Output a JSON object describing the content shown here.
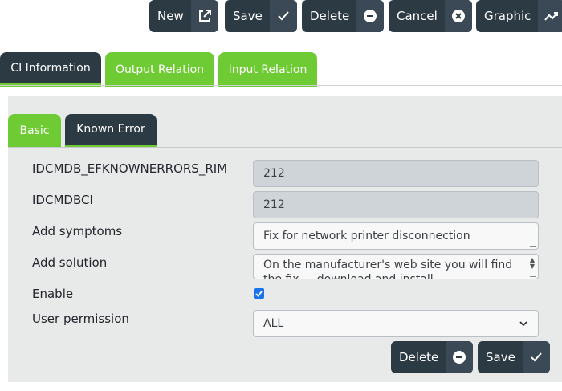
{
  "toolbar": {
    "new_label": "New",
    "save_label": "Save",
    "delete_label": "Delete",
    "cancel_label": "Cancel",
    "graphic_label": "Graphic"
  },
  "tabs": {
    "ci_information": "CI Information",
    "output_relation": "Output Relation",
    "input_relation": "Input Relation"
  },
  "subtabs": {
    "basic": "Basic",
    "known_error": "Known Error"
  },
  "form": {
    "rim_label": "IDCMDB_EFKNOWNERRORS_RIM",
    "rim_value": "212",
    "ci_label": "IDCMDBCI",
    "ci_value": "212",
    "symptoms_label": "Add symptoms",
    "symptoms_value": "Fix for network printer disconnection",
    "solution_label": "Add solution",
    "solution_value": "On the manufacturer's web site you will find the fix ... download and install",
    "enable_label": "Enable",
    "enable_checked": true,
    "permission_label": "User permission",
    "permission_value": "ALL"
  },
  "form_actions": {
    "delete_label": "Delete",
    "save_label": "Save"
  },
  "colors": {
    "dark": "#2c3a44",
    "green": "#6fcb33",
    "panel": "#e8e9e9"
  }
}
